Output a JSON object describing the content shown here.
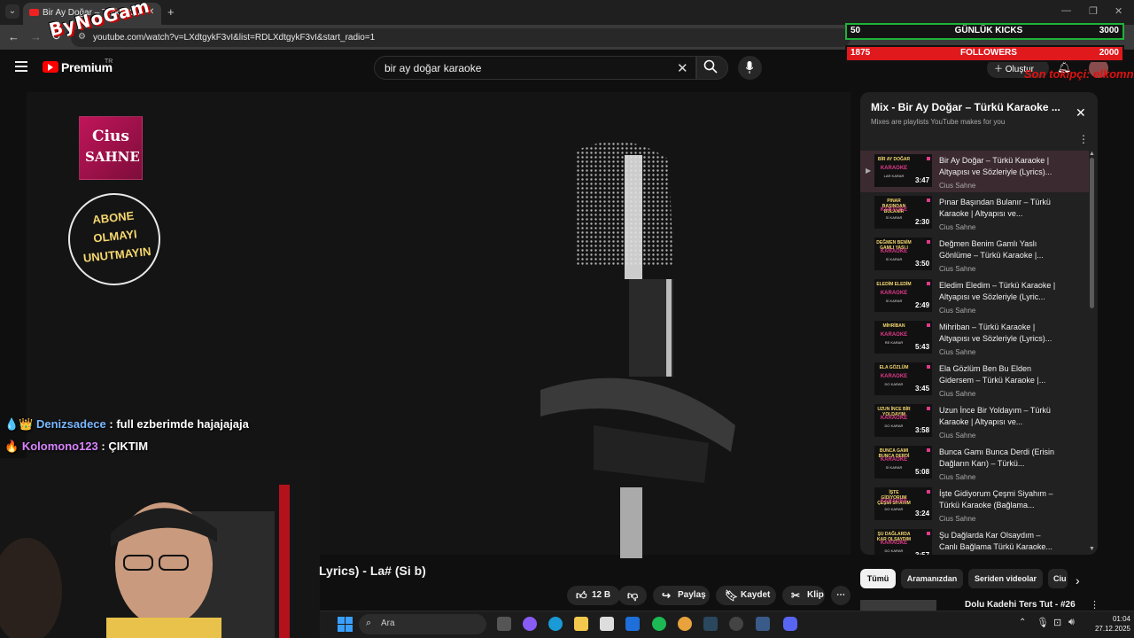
{
  "browser": {
    "tab_title": "Bir Ay Doğar – Türkü Karaoke | ...",
    "url": "youtube.com/watch?v=LXdtgykF3vI&list=RDLXdtgykF3vI&start_radio=1"
  },
  "overlay": {
    "logo_text": "ByNoGam",
    "widget_top": {
      "left": "50",
      "label": "GÜNLÜK KICKS",
      "right": "3000"
    },
    "widget_bottom": {
      "left": "1875",
      "label": "FOLLOWERS",
      "right": "2000"
    },
    "tiktok_note": "Son tokipçi: elkomni",
    "chat": [
      {
        "user": "Denizsadece",
        "message": " : full ezberimde hajajajaja"
      },
      {
        "user": "Kolomono123",
        "message": " : ÇIKTIM"
      }
    ]
  },
  "youtube": {
    "brand": "Premium",
    "region": "TR",
    "search_query": "bir ay doğar karaoke",
    "create_label": "Oluştur",
    "video_title": "Lyrics) - La# (Si b)",
    "video_overlay": {
      "channel_logo_line1": "Cius",
      "channel_logo_line2": "SAHNE",
      "subscribe_text": "ABONE OLMAYI UNUTMAYIN"
    },
    "actions": {
      "like_count": "12 B",
      "share": "Paylaş",
      "save": "Kaydet",
      "clip": "Klip"
    },
    "playlist": {
      "title": "Mix - Bir Ay Doğar – Türkü Karaoke ...",
      "subtitle": "Mixes are playlists YouTube makes for you",
      "items": [
        {
          "title": "Bir Ay Doğar – Türkü Karaoke | Altyapısı ve Sözleriyle (Lyrics)...",
          "channel": "Cius Sahne",
          "duration": "3:47",
          "thumb_top": "BİR AY DOĞAR",
          "thumb_mid": "KARAOKE",
          "thumb_bot": "LAR KARAR"
        },
        {
          "title": "Pınar Başından Bulanır – Türkü Karaoke | Altyapısı ve...",
          "channel": "Cius Sahne",
          "duration": "2:30",
          "thumb_top": "PINAR BAŞINDAN BULANIR",
          "thumb_mid": "KARAOKE",
          "thumb_bot": "Sİ KARAR"
        },
        {
          "title": "Değmen Benim Gamlı Yaslı Gönlüme – Türkü Karaoke |...",
          "channel": "Cius Sahne",
          "duration": "3:50",
          "thumb_top": "DEĞMEN BENİM GAMLI YASLI",
          "thumb_mid": "KARAOKE",
          "thumb_bot": "Sİ KARAR"
        },
        {
          "title": "Eledim Eledim – Türkü Karaoke | Altyapısı ve Sözleriyle (Lyric...",
          "channel": "Cius Sahne",
          "duration": "2:49",
          "thumb_top": "ELEDİM ELEDİM",
          "thumb_mid": "KARAOKE",
          "thumb_bot": "Sİ KARAR"
        },
        {
          "title": "Mihriban – Türkü Karaoke | Altyapısı ve Sözleriyle (Lyrics)...",
          "channel": "Cius Sahne",
          "duration": "5:43",
          "thumb_top": "MİHRİBAN",
          "thumb_mid": "KARAOKE",
          "thumb_bot": "RE KARAR"
        },
        {
          "title": "Ela Gözlüm Ben Bu Elden Gidersem – Türkü Karaoke |...",
          "channel": "Cius Sahne",
          "duration": "3:45",
          "thumb_top": "ELA GÖZLÜM",
          "thumb_mid": "KARAOKE",
          "thumb_bot": "DO KARAR"
        },
        {
          "title": "Uzun İnce Bir Yoldayım – Türkü Karaoke | Altyapısı ve...",
          "channel": "Cius Sahne",
          "duration": "3:58",
          "thumb_top": "UZUN İNCE BİR YOLDAYIM",
          "thumb_mid": "KARAOKE",
          "thumb_bot": "DO KARAR"
        },
        {
          "title": "Bunca Gamı Bunca Derdi (Erisin Dağların Karı) – Türkü...",
          "channel": "Cius Sahne",
          "duration": "5:08",
          "thumb_top": "BUNCA GAMI BUNCA DERDİ",
          "thumb_mid": "KARAOKE",
          "thumb_bot": "Sİ KARAR"
        },
        {
          "title": "İşte Gidiyorum Çeşmi Siyahım – Türkü Karaoke (Bağlama...",
          "channel": "Cius Sahne",
          "duration": "3:24",
          "thumb_top": "İŞTE GİDİYORUM ÇEŞMİ SİYAHIM",
          "thumb_mid": "KARAOKE",
          "thumb_bot": "DO KARAR"
        },
        {
          "title": "Şu Dağlarda Kar Olsaydım – Canlı Bağlama Türkü Karaoke...",
          "channel": "",
          "duration": "3:57",
          "thumb_top": "ŞU DAĞLARDA KAR OLSAYDIM",
          "thumb_mid": "KARAOKE",
          "thumb_bot": "DO KARAR"
        }
      ]
    },
    "chips": [
      "Tümü",
      "Aramanızdan",
      "Seriden videolar",
      "Ciu"
    ],
    "recommended_title": "Dolu Kadehi Ters Tut - #26"
  },
  "taskbar": {
    "search_placeholder": "Ara",
    "time": "01:04",
    "date": "27.12.2025"
  }
}
